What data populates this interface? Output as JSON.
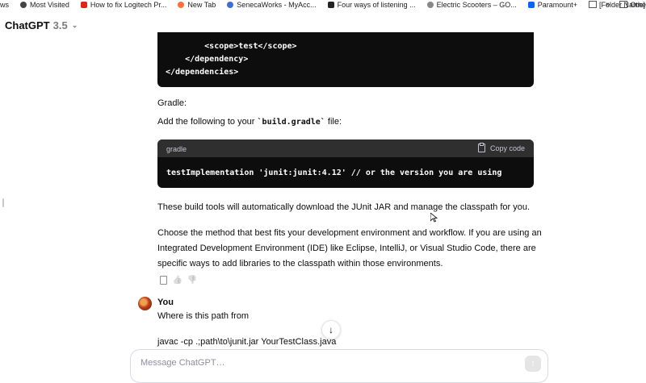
{
  "bookmarks": {
    "items": [
      {
        "label": "ws",
        "icon": "none"
      },
      {
        "label": "Most Visited",
        "icon": "gear-icon"
      },
      {
        "label": "How to fix Logitech Pr...",
        "icon": "youtube-icon"
      },
      {
        "label": "New Tab",
        "icon": "firefox-icon"
      },
      {
        "label": "SenecaWorks - MyAcc...",
        "icon": "globe-icon"
      },
      {
        "label": "Four ways of listening ...",
        "icon": "page-icon"
      },
      {
        "label": "Electric Scooters – GO...",
        "icon": "globe-icon"
      },
      {
        "label": "Paramount+",
        "icon": "paramount-icon"
      },
      {
        "label": "[Folder Name]",
        "icon": "folder-icon"
      }
    ],
    "overflow_chevron": "»",
    "other": "Othe"
  },
  "header": {
    "title": "ChatGPT",
    "version": "3.5",
    "caret": "⌄"
  },
  "code_block_1": {
    "lines": [
      "        <scope>test</scope>",
      "    </dependency>",
      "</dependencies>"
    ]
  },
  "gradle_heading": "Gradle:",
  "gradle_instruction": {
    "before": "Add the following to your ",
    "code": "`build.gradle`",
    "after": " file:"
  },
  "code_block_2": {
    "language": "gradle",
    "copy_label": "Copy code",
    "code": "testImplementation 'junit:junit:4.12' // or the version you are using"
  },
  "para_build_tools": "These build tools will automatically download the JUnit JAR and manage the classpath for you.",
  "para_choose": [
    "Choose the method that best fits your development environment and workflow. If you are using an",
    "Integrated Development Environment (IDE) like Eclipse, IntelliJ, or Visual Studio Code, there are",
    "specific ways to add libraries to the classpath within those environments."
  ],
  "message_actions": {
    "copy": "copy-icon",
    "thumbs_up": "👍",
    "thumbs_down": "👎"
  },
  "user_message": {
    "author": "You",
    "line1": "Where is this path from",
    "line2": "javac -cp .;path\\to\\junit.jar YourTestClass.java"
  },
  "scroll_down": "↓",
  "composer": {
    "placeholder": "Message ChatGPT…",
    "send": "↑"
  },
  "colors": {
    "code_bg": "#0d0d0d",
    "code_header_bg": "#2f2f2f",
    "text": "#0d0d0d",
    "muted": "#8e8ea0"
  }
}
